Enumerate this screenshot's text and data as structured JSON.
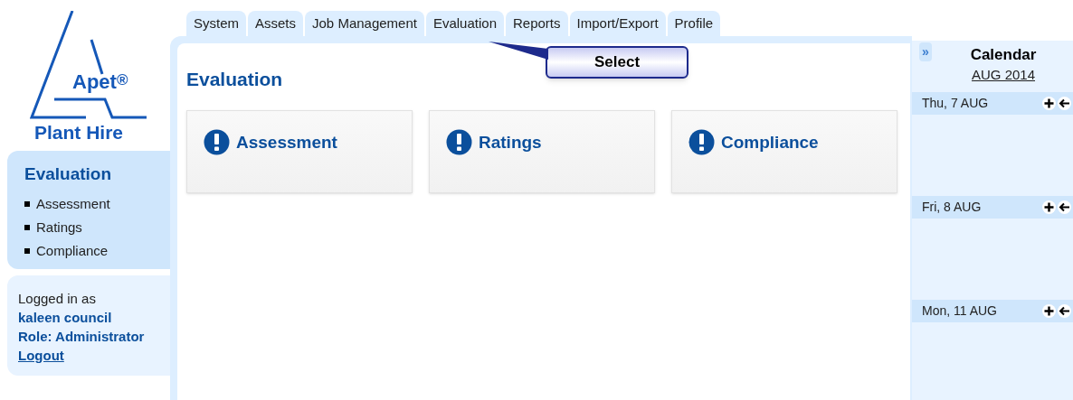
{
  "logo": {
    "brand": "Apet",
    "mark": "®",
    "subtitle": "Plant Hire"
  },
  "tabs": [
    {
      "label": "System"
    },
    {
      "label": "Assets"
    },
    {
      "label": "Job Management"
    },
    {
      "label": "Evaluation"
    },
    {
      "label": "Reports"
    },
    {
      "label": "Import/Export"
    },
    {
      "label": "Profile"
    }
  ],
  "callout": {
    "text": "Select"
  },
  "sidebar": {
    "title": "Evaluation",
    "items": [
      "Assessment",
      "Ratings",
      "Compliance"
    ]
  },
  "user_box": {
    "intro": "Logged in as",
    "user": "kaleen council",
    "role": "Role: Administrator",
    "logout": "Logout"
  },
  "page_title": "Evaluation",
  "cards": [
    {
      "label": "Assessment"
    },
    {
      "label": "Ratings"
    },
    {
      "label": "Compliance"
    }
  ],
  "calendar": {
    "collapse": "»",
    "title": "Calendar",
    "month": "AUG 2014",
    "days": [
      {
        "label": "Thu, 7 AUG"
      },
      {
        "label": "Fri, 8 AUG"
      },
      {
        "label": "Mon, 11 AUG"
      }
    ]
  }
}
